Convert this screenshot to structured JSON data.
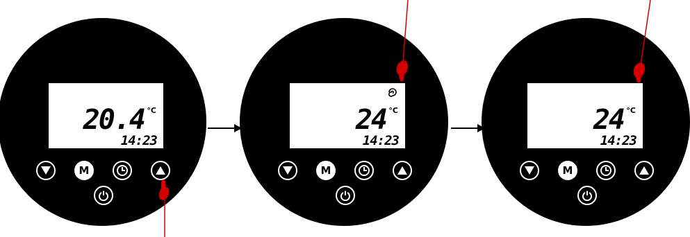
{
  "panels": [
    {
      "temperature": "20.4",
      "unit": "°C",
      "time": "14:23",
      "fan_icon": false,
      "pressed_button": "up"
    },
    {
      "temperature": "24",
      "unit": "°C",
      "time": "14:23",
      "fan_icon": true,
      "pressed_button": "fan-indicator"
    },
    {
      "temperature": "24",
      "unit": "°C",
      "time": "14:23",
      "fan_icon": false,
      "pressed_button": "screen-corner"
    }
  ],
  "buttons": {
    "down": "down-triangle-icon",
    "mode": "M",
    "timer": "clock-icon",
    "up": "up-triangle-icon",
    "power": "power-icon"
  },
  "colors": {
    "dial": "#000000",
    "screen": "#ffffff",
    "pointer": "#d40000",
    "arrow": "#000000"
  }
}
